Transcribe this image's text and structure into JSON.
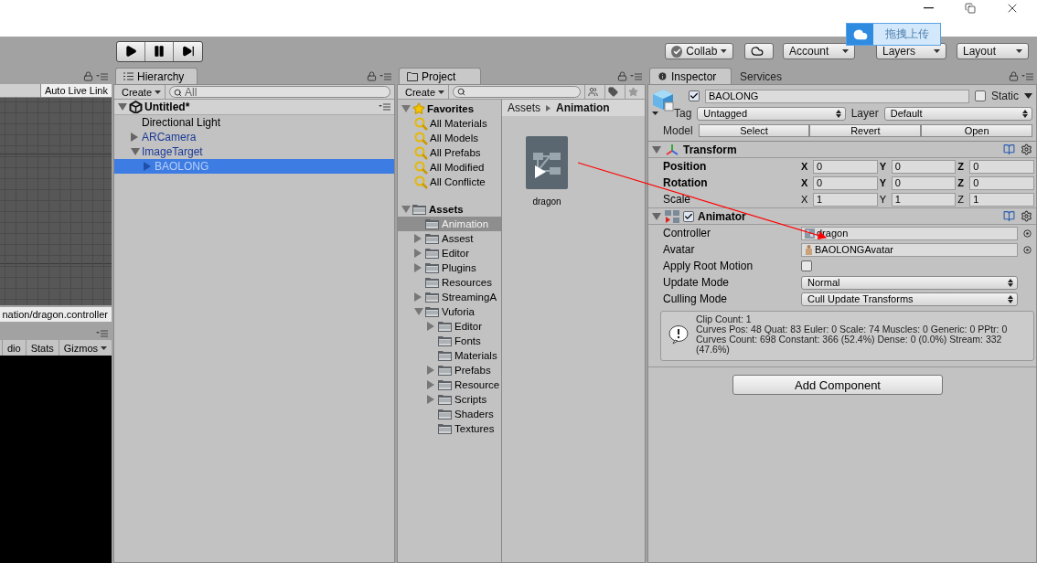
{
  "upload_badge": {
    "label": "拖拽上传"
  },
  "toolbar": {
    "collab": "Collab",
    "account": "Account",
    "layers": "Layers",
    "layout": "Layout"
  },
  "scene": {
    "live_link": "Auto Live Link",
    "path": "nation/dragon.controller",
    "tabs": [
      "dio",
      "Stats",
      "Gizmos"
    ]
  },
  "hierarchy": {
    "tab": "Hierarchy",
    "create": "Create",
    "search": {
      "placeholder": "All"
    },
    "scene": {
      "label": "Untitled*",
      "expanded": true,
      "children": [
        {
          "label": "Directional Light",
          "prefab": false,
          "selected": false
        },
        {
          "label": "ARCamera",
          "expanded": false,
          "prefab": true,
          "selected": false
        },
        {
          "label": "ImageTarget",
          "expanded": true,
          "prefab": true,
          "selected": false,
          "children": [
            {
              "label": "BAOLONG",
              "expanded": false,
              "prefab": true,
              "selected": true
            }
          ]
        }
      ]
    }
  },
  "project": {
    "tab": "Project",
    "create": "Create",
    "favorites": {
      "label": "Favorites",
      "expanded": true,
      "items": [
        "All Materials",
        "All Models",
        "All Prefabs",
        "All Modified",
        "All Conflicte"
      ]
    },
    "assets": {
      "label": "Assets",
      "expanded": true,
      "children": [
        {
          "label": "Animation",
          "selected": true
        },
        {
          "label": "Assest",
          "expanded": false,
          "selected": false
        },
        {
          "label": "Editor",
          "expanded": false,
          "selected": false
        },
        {
          "label": "Plugins",
          "expanded": false,
          "selected": false
        },
        {
          "label": "Resources",
          "selected": false
        },
        {
          "label": "StreamingA",
          "expanded": false,
          "selected": false
        },
        {
          "label": "Vuforia",
          "expanded": true,
          "selected": false,
          "children": [
            {
              "label": "Editor",
              "expanded": false,
              "selected": false
            },
            {
              "label": "Fonts",
              "selected": false
            },
            {
              "label": "Materials",
              "selected": false
            },
            {
              "label": "Prefabs",
              "expanded": false,
              "selected": false
            },
            {
              "label": "Resource",
              "expanded": false,
              "selected": false
            },
            {
              "label": "Scripts",
              "expanded": false,
              "selected": false
            },
            {
              "label": "Shaders",
              "selected": false
            },
            {
              "label": "Textures",
              "selected": false
            }
          ]
        }
      ]
    },
    "breadcrumb": [
      "Assets",
      "Animation"
    ],
    "files": [
      "dragon"
    ]
  },
  "inspector": {
    "tabs": [
      {
        "label": "Inspector",
        "selected": true
      },
      {
        "label": "Services",
        "selected": false
      }
    ],
    "object": {
      "active": true,
      "name": "BAOLONG",
      "static_label": "Static",
      "static": false,
      "tag_label": "Tag",
      "tag": "Untagged",
      "layer_label": "Layer",
      "layer": "Default",
      "model_label": "Model",
      "model_buttons": [
        "Select",
        "Revert",
        "Open"
      ]
    },
    "components": [
      {
        "kind": "transform",
        "title": "Transform",
        "expanded": true,
        "rows": [
          {
            "label": "Position",
            "bold": true,
            "fields": [
              {
                "axis": "X",
                "value": "0"
              },
              {
                "axis": "Y",
                "value": "0"
              },
              {
                "axis": "Z",
                "value": "0"
              }
            ]
          },
          {
            "label": "Rotation",
            "bold": true,
            "fields": [
              {
                "axis": "X",
                "value": "0"
              },
              {
                "axis": "Y",
                "value": "0"
              },
              {
                "axis": "Z",
                "value": "0"
              }
            ]
          },
          {
            "label": "Scale",
            "bold": false,
            "fields": [
              {
                "axis": "X",
                "value": "1"
              },
              {
                "axis": "Y",
                "value": "1"
              },
              {
                "axis": "Z",
                "value": "1"
              }
            ]
          }
        ]
      },
      {
        "kind": "animator",
        "title": "Animator",
        "expanded": true,
        "enabled": true,
        "properties": [
          {
            "kind": "object",
            "label": "Controller",
            "value": "dragon"
          },
          {
            "kind": "object",
            "label": "Avatar",
            "value": "BAOLONGAvatar"
          },
          {
            "kind": "checkbox",
            "label": "Apply Root Motion",
            "checked": false
          },
          {
            "kind": "dropdown",
            "label": "Update Mode",
            "value": "Normal"
          },
          {
            "kind": "dropdown",
            "label": "Culling Mode",
            "value": "Cull Update Transforms"
          }
        ],
        "info": [
          "Clip Count: 1",
          "Curves Pos: 48 Quat: 83 Euler: 0 Scale: 74 Muscles: 0 Generic: 0 PPtr: 0",
          "Curves Count: 698 Constant: 366 (52.4%) Dense: 0 (0.0%) Stream: 332 (47.6%)"
        ]
      }
    ],
    "add_component": "Add Component"
  }
}
